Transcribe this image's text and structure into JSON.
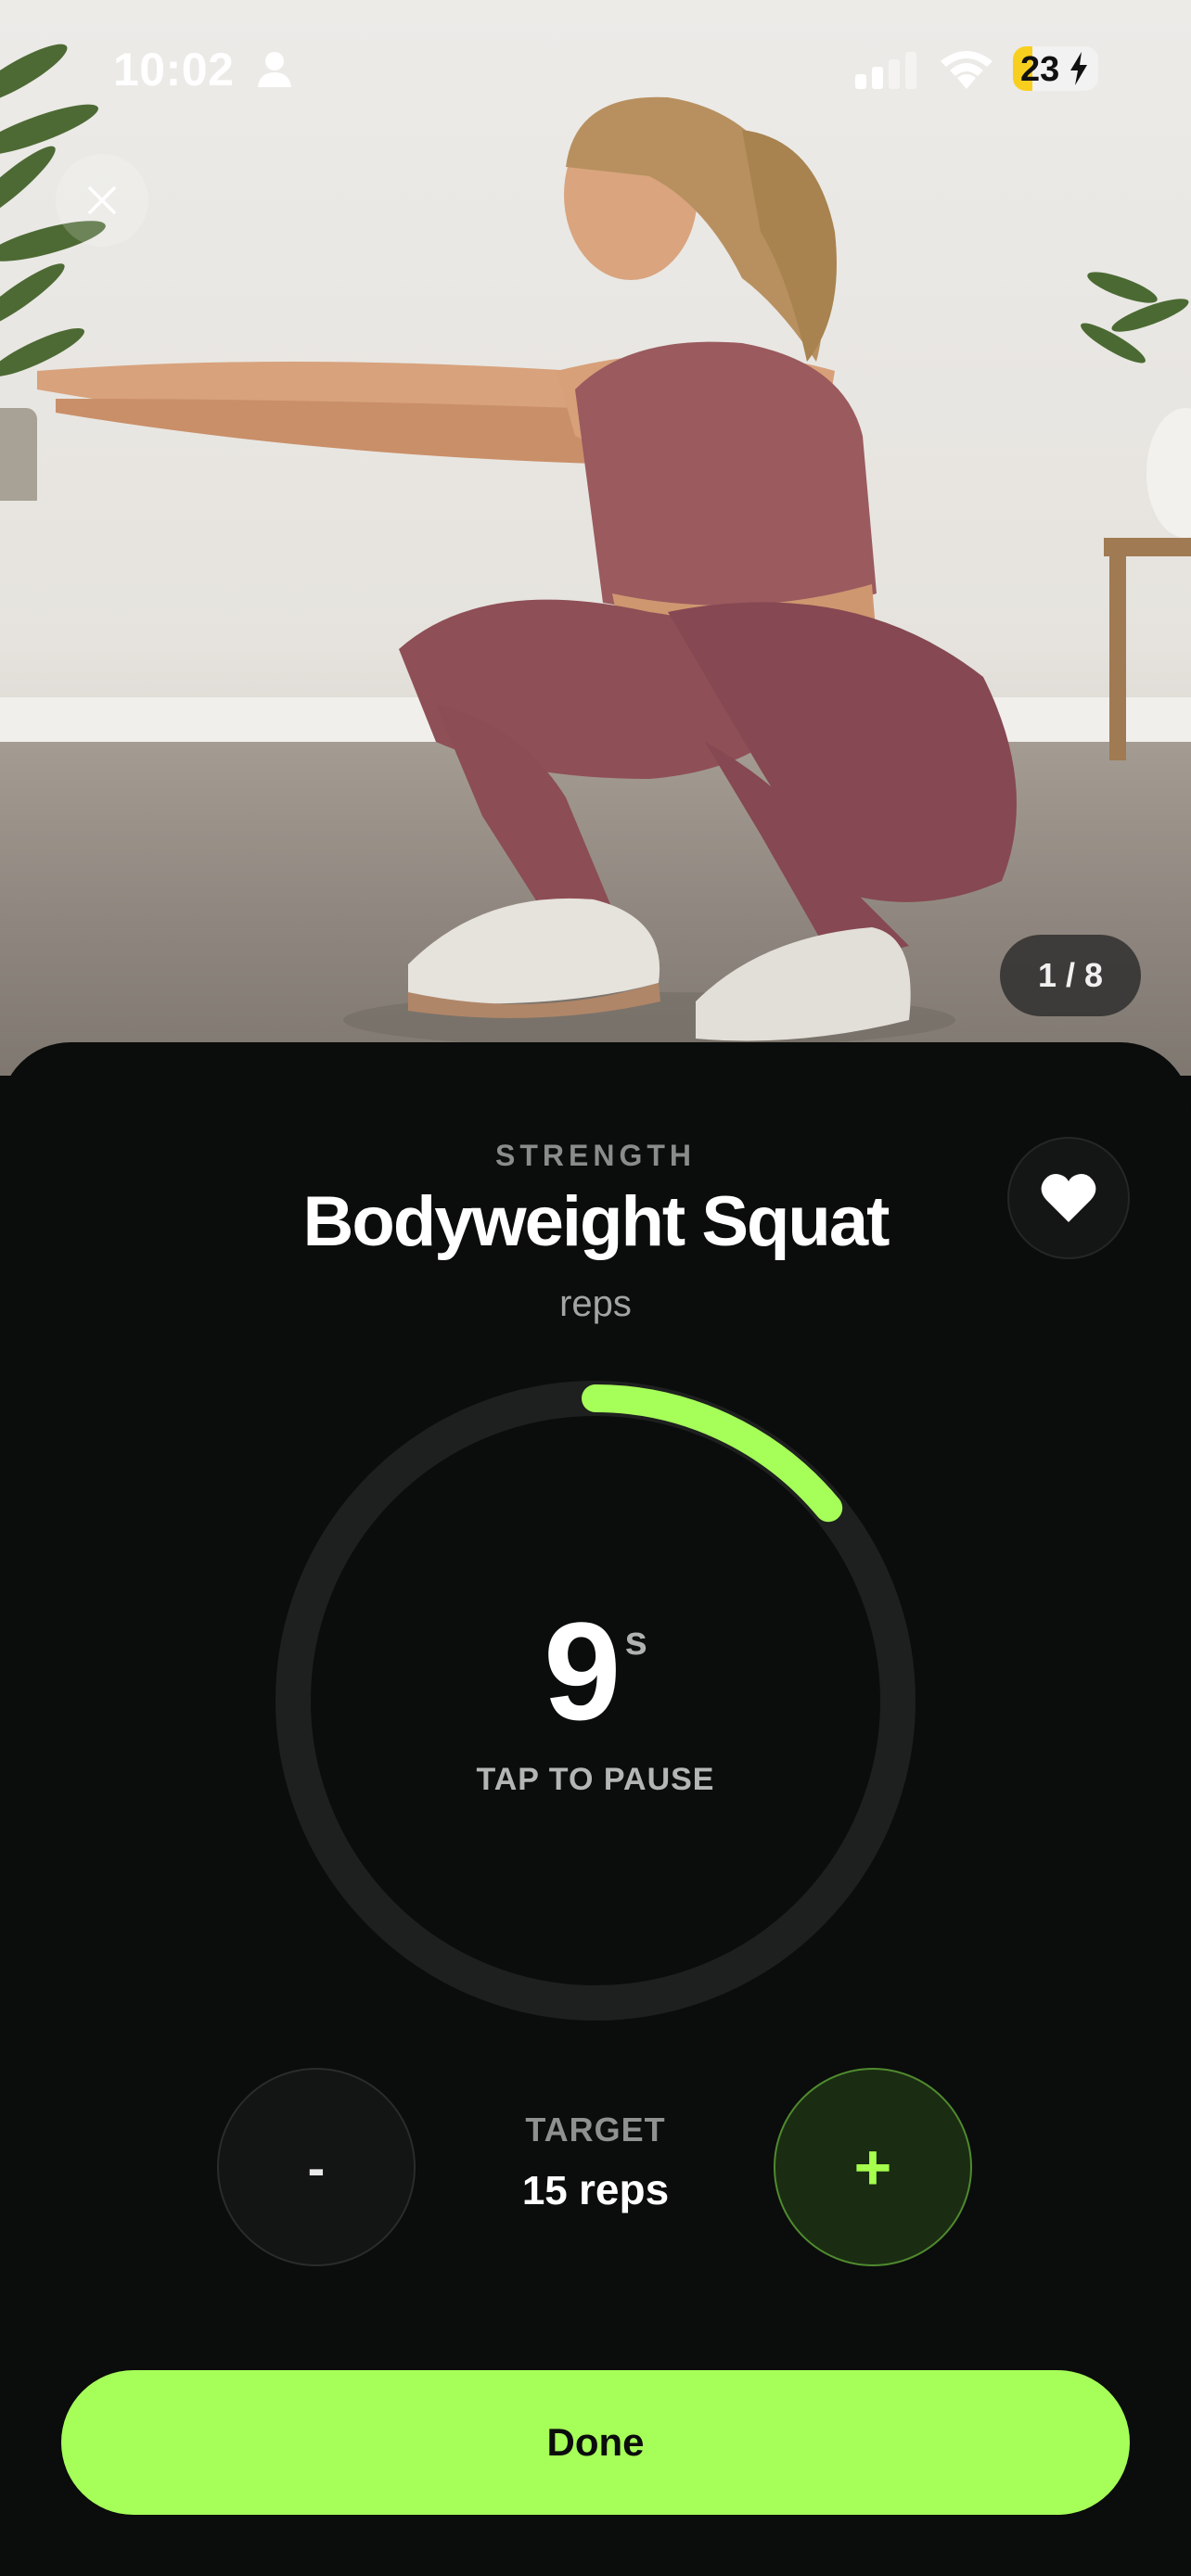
{
  "status_bar": {
    "time": "10:02",
    "battery_level": "23",
    "battery_fraction": 0.23,
    "icons": [
      "person-icon",
      "cellular-signal-icon",
      "wifi-icon",
      "battery-charging-icon"
    ]
  },
  "hero": {
    "image_subject": "woman in mauve workout set performing a bodyweight squat with arms extended",
    "counter": "1 / 8"
  },
  "exercise": {
    "category": "STRENGTH",
    "name": "Bodyweight Squat",
    "mode": "reps"
  },
  "timer": {
    "value": "9",
    "unit": "s",
    "hint": "TAP TO PAUSE",
    "progress_fraction": 0.14
  },
  "target": {
    "label": "TARGET",
    "value": "15",
    "unit": "reps",
    "decrement_label": "-",
    "increment_label": "+"
  },
  "actions": {
    "done_label": "Done"
  },
  "colors": {
    "accent": "#a6ff59",
    "sheet_background": "#0b0c0c",
    "ring_track": "#1e1f1f"
  }
}
